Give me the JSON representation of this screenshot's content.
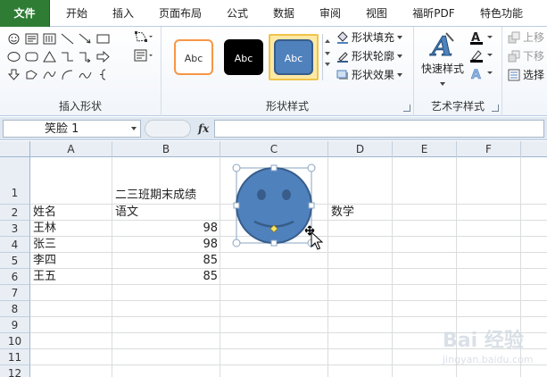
{
  "tabs": [
    {
      "id": "file",
      "label": "文件"
    },
    {
      "id": "home",
      "label": "开始"
    },
    {
      "id": "insert",
      "label": "插入"
    },
    {
      "id": "layout",
      "label": "页面布局"
    },
    {
      "id": "formulas",
      "label": "公式"
    },
    {
      "id": "data",
      "label": "数据"
    },
    {
      "id": "review",
      "label": "审阅"
    },
    {
      "id": "view",
      "label": "视图"
    },
    {
      "id": "foxit",
      "label": "福昕PDF"
    },
    {
      "id": "special",
      "label": "特色功能"
    }
  ],
  "ribbon": {
    "insert_shapes_label": "插入形状",
    "shape_styles_label": "形状样式",
    "wordart_label": "艺术字样式",
    "style_previews": [
      {
        "text": "Abc"
      },
      {
        "text": "Abc"
      },
      {
        "text": "Abc"
      }
    ],
    "shape_fill": "形状填充",
    "shape_outline": "形状轮廓",
    "shape_effects": "形状效果",
    "quick_styles": "快速样式",
    "bring_forward": "上移",
    "send_backward": "下移",
    "selection_pane": "选择"
  },
  "formula_bar": {
    "name_box": "笑脸 1",
    "fx": "fx",
    "formula": ""
  },
  "sheet": {
    "columns": [
      "A",
      "B",
      "C",
      "D",
      "E",
      "F"
    ],
    "rows": [
      "1",
      "2",
      "3",
      "4",
      "5",
      "6",
      "7",
      "8",
      "9",
      "10",
      "11",
      "12"
    ],
    "title": "二三班期末成绩",
    "header_name": "姓名",
    "header_chinese": "语文",
    "header_math": "数学",
    "names": [
      "王林",
      "张三",
      "李四",
      "王五"
    ],
    "scores": [
      "98",
      "98",
      "85",
      "85"
    ]
  },
  "colors": {
    "file_tab": "#2f7d35",
    "smiley_fill": "#4f81bd",
    "smiley_outline": "#385d8a",
    "selection_handle": "#8aa4c1",
    "adjust_handle": "#f7e468"
  },
  "watermark": {
    "text": "Bai 经验",
    "sub": "jingyan.baidu.com"
  }
}
